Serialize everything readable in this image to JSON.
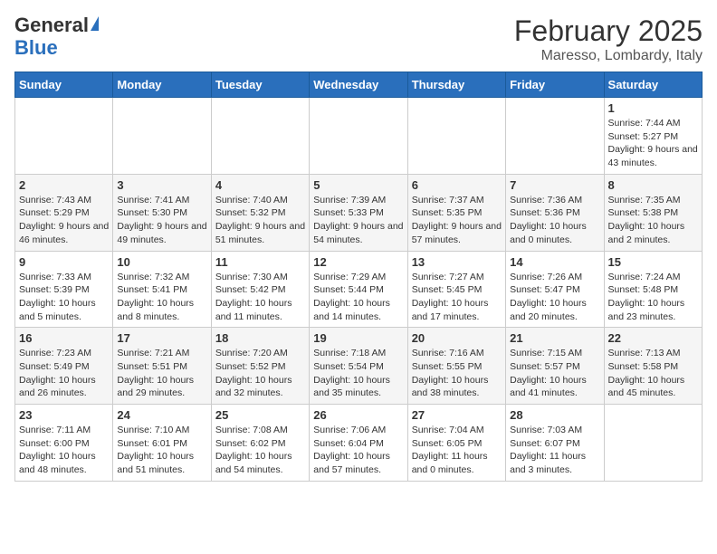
{
  "logo": {
    "general": "General",
    "blue": "Blue"
  },
  "header": {
    "month": "February 2025",
    "location": "Maresso, Lombardy, Italy"
  },
  "weekdays": [
    "Sunday",
    "Monday",
    "Tuesday",
    "Wednesday",
    "Thursday",
    "Friday",
    "Saturday"
  ],
  "weeks": [
    [
      {
        "day": "",
        "sunrise": "",
        "sunset": "",
        "daylight": ""
      },
      {
        "day": "",
        "sunrise": "",
        "sunset": "",
        "daylight": ""
      },
      {
        "day": "",
        "sunrise": "",
        "sunset": "",
        "daylight": ""
      },
      {
        "day": "",
        "sunrise": "",
        "sunset": "",
        "daylight": ""
      },
      {
        "day": "",
        "sunrise": "",
        "sunset": "",
        "daylight": ""
      },
      {
        "day": "",
        "sunrise": "",
        "sunset": "",
        "daylight": ""
      },
      {
        "day": "1",
        "sunrise": "7:44 AM",
        "sunset": "5:27 PM",
        "daylight": "9 hours and 43 minutes."
      }
    ],
    [
      {
        "day": "2",
        "sunrise": "7:43 AM",
        "sunset": "5:29 PM",
        "daylight": "9 hours and 46 minutes."
      },
      {
        "day": "3",
        "sunrise": "7:41 AM",
        "sunset": "5:30 PM",
        "daylight": "9 hours and 49 minutes."
      },
      {
        "day": "4",
        "sunrise": "7:40 AM",
        "sunset": "5:32 PM",
        "daylight": "9 hours and 51 minutes."
      },
      {
        "day": "5",
        "sunrise": "7:39 AM",
        "sunset": "5:33 PM",
        "daylight": "9 hours and 54 minutes."
      },
      {
        "day": "6",
        "sunrise": "7:37 AM",
        "sunset": "5:35 PM",
        "daylight": "9 hours and 57 minutes."
      },
      {
        "day": "7",
        "sunrise": "7:36 AM",
        "sunset": "5:36 PM",
        "daylight": "10 hours and 0 minutes."
      },
      {
        "day": "8",
        "sunrise": "7:35 AM",
        "sunset": "5:38 PM",
        "daylight": "10 hours and 2 minutes."
      }
    ],
    [
      {
        "day": "9",
        "sunrise": "7:33 AM",
        "sunset": "5:39 PM",
        "daylight": "10 hours and 5 minutes."
      },
      {
        "day": "10",
        "sunrise": "7:32 AM",
        "sunset": "5:41 PM",
        "daylight": "10 hours and 8 minutes."
      },
      {
        "day": "11",
        "sunrise": "7:30 AM",
        "sunset": "5:42 PM",
        "daylight": "10 hours and 11 minutes."
      },
      {
        "day": "12",
        "sunrise": "7:29 AM",
        "sunset": "5:44 PM",
        "daylight": "10 hours and 14 minutes."
      },
      {
        "day": "13",
        "sunrise": "7:27 AM",
        "sunset": "5:45 PM",
        "daylight": "10 hours and 17 minutes."
      },
      {
        "day": "14",
        "sunrise": "7:26 AM",
        "sunset": "5:47 PM",
        "daylight": "10 hours and 20 minutes."
      },
      {
        "day": "15",
        "sunrise": "7:24 AM",
        "sunset": "5:48 PM",
        "daylight": "10 hours and 23 minutes."
      }
    ],
    [
      {
        "day": "16",
        "sunrise": "7:23 AM",
        "sunset": "5:49 PM",
        "daylight": "10 hours and 26 minutes."
      },
      {
        "day": "17",
        "sunrise": "7:21 AM",
        "sunset": "5:51 PM",
        "daylight": "10 hours and 29 minutes."
      },
      {
        "day": "18",
        "sunrise": "7:20 AM",
        "sunset": "5:52 PM",
        "daylight": "10 hours and 32 minutes."
      },
      {
        "day": "19",
        "sunrise": "7:18 AM",
        "sunset": "5:54 PM",
        "daylight": "10 hours and 35 minutes."
      },
      {
        "day": "20",
        "sunrise": "7:16 AM",
        "sunset": "5:55 PM",
        "daylight": "10 hours and 38 minutes."
      },
      {
        "day": "21",
        "sunrise": "7:15 AM",
        "sunset": "5:57 PM",
        "daylight": "10 hours and 41 minutes."
      },
      {
        "day": "22",
        "sunrise": "7:13 AM",
        "sunset": "5:58 PM",
        "daylight": "10 hours and 45 minutes."
      }
    ],
    [
      {
        "day": "23",
        "sunrise": "7:11 AM",
        "sunset": "6:00 PM",
        "daylight": "10 hours and 48 minutes."
      },
      {
        "day": "24",
        "sunrise": "7:10 AM",
        "sunset": "6:01 PM",
        "daylight": "10 hours and 51 minutes."
      },
      {
        "day": "25",
        "sunrise": "7:08 AM",
        "sunset": "6:02 PM",
        "daylight": "10 hours and 54 minutes."
      },
      {
        "day": "26",
        "sunrise": "7:06 AM",
        "sunset": "6:04 PM",
        "daylight": "10 hours and 57 minutes."
      },
      {
        "day": "27",
        "sunrise": "7:04 AM",
        "sunset": "6:05 PM",
        "daylight": "11 hours and 0 minutes."
      },
      {
        "day": "28",
        "sunrise": "7:03 AM",
        "sunset": "6:07 PM",
        "daylight": "11 hours and 3 minutes."
      },
      {
        "day": "",
        "sunrise": "",
        "sunset": "",
        "daylight": ""
      }
    ]
  ]
}
